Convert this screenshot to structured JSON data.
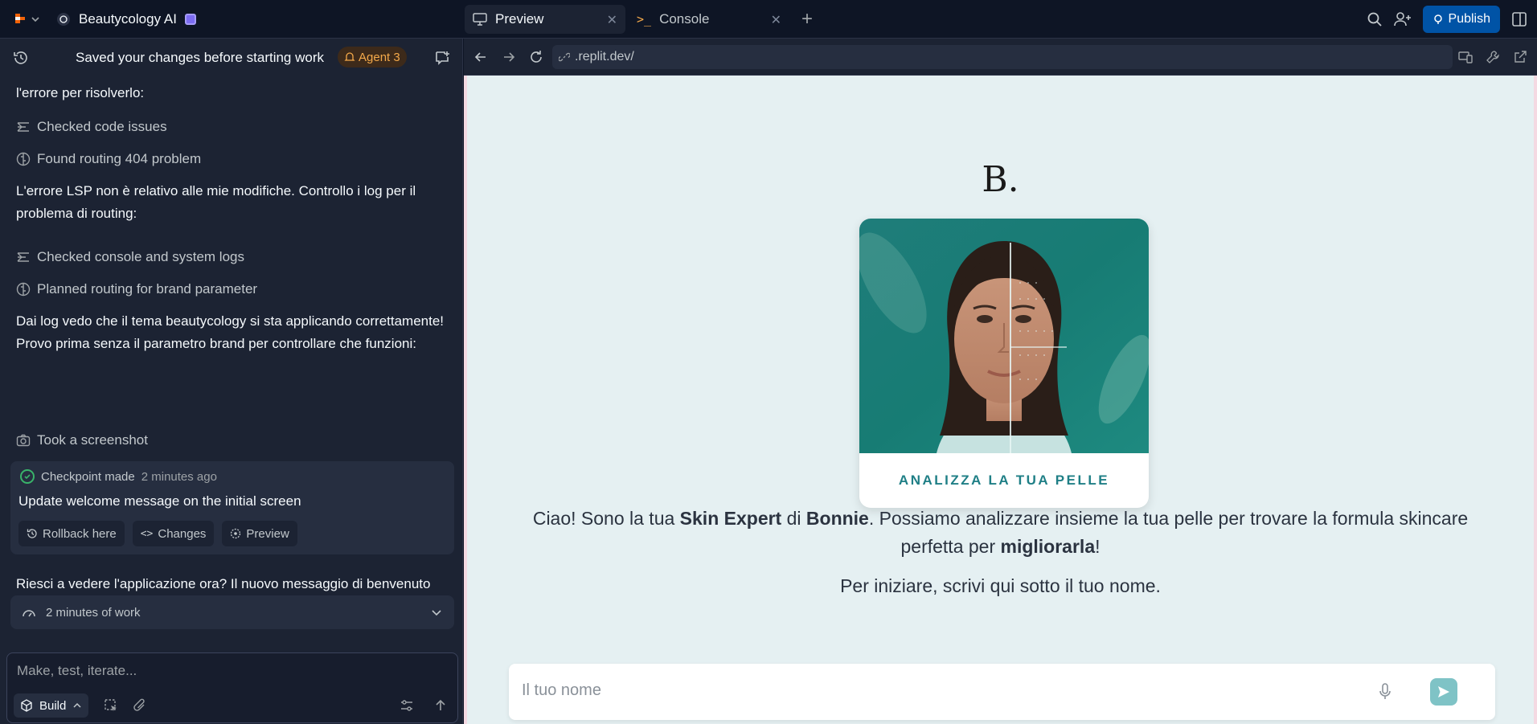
{
  "topbar": {
    "app_name": "Beautycology AI",
    "tabs": [
      {
        "label": "Preview",
        "active": true
      },
      {
        "label": "Console",
        "active": false
      }
    ],
    "publish_label": "Publish"
  },
  "left": {
    "status_text": "Saved your changes before starting work",
    "agent_badge": "Agent 3",
    "messages": {
      "m1": "l'errore per risolverlo:",
      "m2": "L'errore LSP non è relativo alle mie modifiche. Controllo i log per il problema di routing:",
      "m3": "Dai log vedo che il tema beautycology si sta applicando correttamente! Provo prima senza il parametro brand per controllare che funzioni:",
      "m4": "Riesci a vedere l'applicazione ora? Il nuovo messaggio di benvenuto dovrebbe essere attivo"
    },
    "actions": {
      "a1": "Checked code issues",
      "a2": "Found routing 404 problem",
      "a3": "Checked console and system logs",
      "a4": "Planned routing for brand parameter",
      "a5": "Took a screenshot"
    },
    "checkpoint": {
      "title": "Checkpoint made",
      "time": "2 minutes ago",
      "message": "Update welcome message on the initial screen",
      "rollback_label": "Rollback here",
      "changes_label": "Changes",
      "preview_label": "Preview"
    },
    "work_summary": "2 minutes of work",
    "composer": {
      "placeholder": "Make, test, iterate...",
      "mode_label": "Build"
    }
  },
  "preview": {
    "url": ".replit.dev/",
    "brand_mark": "B.",
    "card_cta": "ANALIZZA LA TUA PELLE",
    "intro": {
      "p1": "Ciao! Sono la tua ",
      "b1": "Skin Expert",
      "p2": " di ",
      "b2": "Bonnie",
      "p3": ". Possiamo analizzare insieme la tua pelle per trovare la formula skincare perfetta per ",
      "b3": "migliorarla",
      "p4": "!"
    },
    "instruction": "Per iniziare, scrivi qui sotto il tuo nome.",
    "name_placeholder": "Il tuo nome"
  },
  "colors": {
    "accent_publish": "#0053a6",
    "agent_badge": "#f4a94a",
    "checkpoint_ok": "#39b36a",
    "cta_teal": "#1f7f86",
    "send_button": "#7fc3c6",
    "preview_bg": "#e5f0f2"
  }
}
